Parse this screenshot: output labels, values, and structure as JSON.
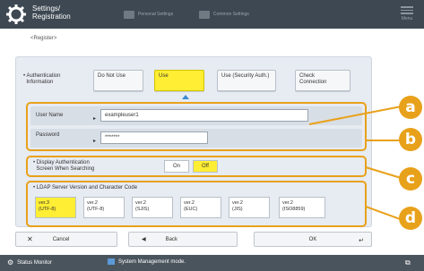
{
  "header": {
    "title_line1": "Settings/",
    "title_line2": "Registration",
    "tab1": "Personal Settings",
    "tab2": "Common Settings",
    "menu_label": "Menu"
  },
  "breadcrumb": "<Register>",
  "auth": {
    "label_line1": "Authentication",
    "label_line2": "Information",
    "options": [
      "Do Not Use",
      "Use",
      "Use (Security Auth.)"
    ],
    "check_line1": "Check",
    "check_line2": "Connection"
  },
  "credentials": {
    "user_label": "User Name",
    "user_value": "exampleuser1",
    "password_label": "Password",
    "password_value": "*******"
  },
  "display_auth": {
    "label_line1": "Display Authentication",
    "label_line2": "Screen When Searching",
    "on": "On",
    "off": "Off"
  },
  "ldap": {
    "title": "LDAP Server Version and Character Code",
    "options": [
      {
        "l1": "ver.3",
        "l2": "(UTF-8)"
      },
      {
        "l1": "ver.2",
        "l2": "(UTF-8)"
      },
      {
        "l1": "ver.2",
        "l2": "(SJIS)"
      },
      {
        "l1": "ver.2",
        "l2": "(EUC)"
      },
      {
        "l1": "ver.2",
        "l2": "(JIS)"
      },
      {
        "l1": "ver.2",
        "l2": "(ISO8859)"
      }
    ]
  },
  "callouts": [
    "a",
    "b",
    "c",
    "d"
  ],
  "footer": {
    "cancel": "Cancel",
    "back": "Back",
    "ok": "OK"
  },
  "status": {
    "monitor": "Status Monitor",
    "mode": "System Management mode."
  },
  "colors": {
    "accent": "#e8a11a",
    "selected": "#ffee33",
    "header": "#3d4852"
  }
}
